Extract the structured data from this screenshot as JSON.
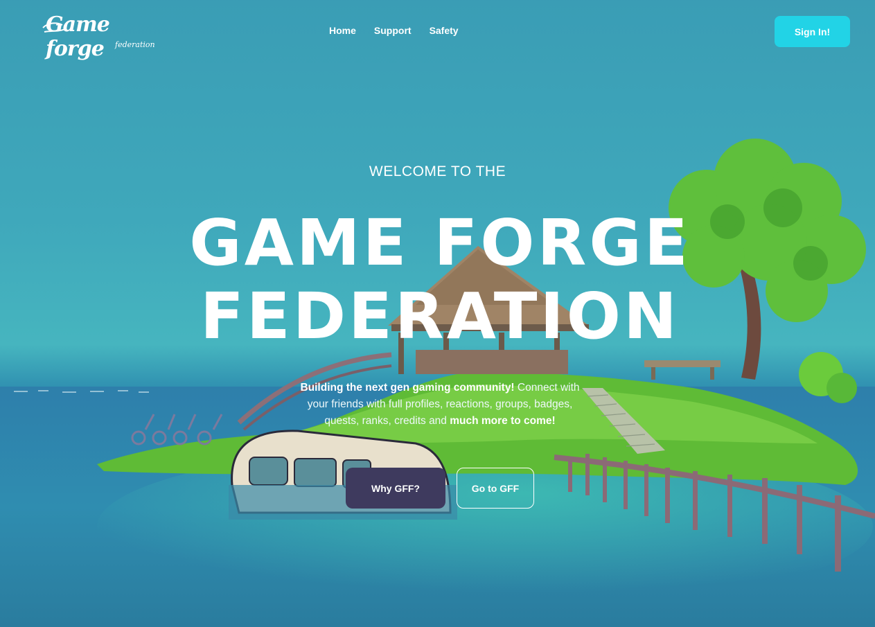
{
  "brand": {
    "logo_text": "Game forge",
    "logo_subtext": "federation"
  },
  "nav": {
    "items": [
      {
        "label": "Home"
      },
      {
        "label": "Support"
      },
      {
        "label": "Safety"
      }
    ]
  },
  "header": {
    "signin_label": "Sign In!"
  },
  "hero": {
    "welcome": "WELCOME TO THE",
    "title_line1": "GAME FORGE",
    "title_line2": "FEDERATION",
    "desc_bold1": "Building the next gen gaming community!",
    "desc_text": " Connect with your friends with full profiles, reactions, groups, badges, quests, ranks, credits and ",
    "desc_bold2": "much more to come!",
    "primary_button": "Why GFF?",
    "secondary_button": "Go to GFF"
  },
  "colors": {
    "accent": "#22d3e6",
    "primary_button": "#3e3a5e",
    "sky": "#3fa8bb",
    "sea": "#2b86a6",
    "grass": "#6cc23a"
  }
}
